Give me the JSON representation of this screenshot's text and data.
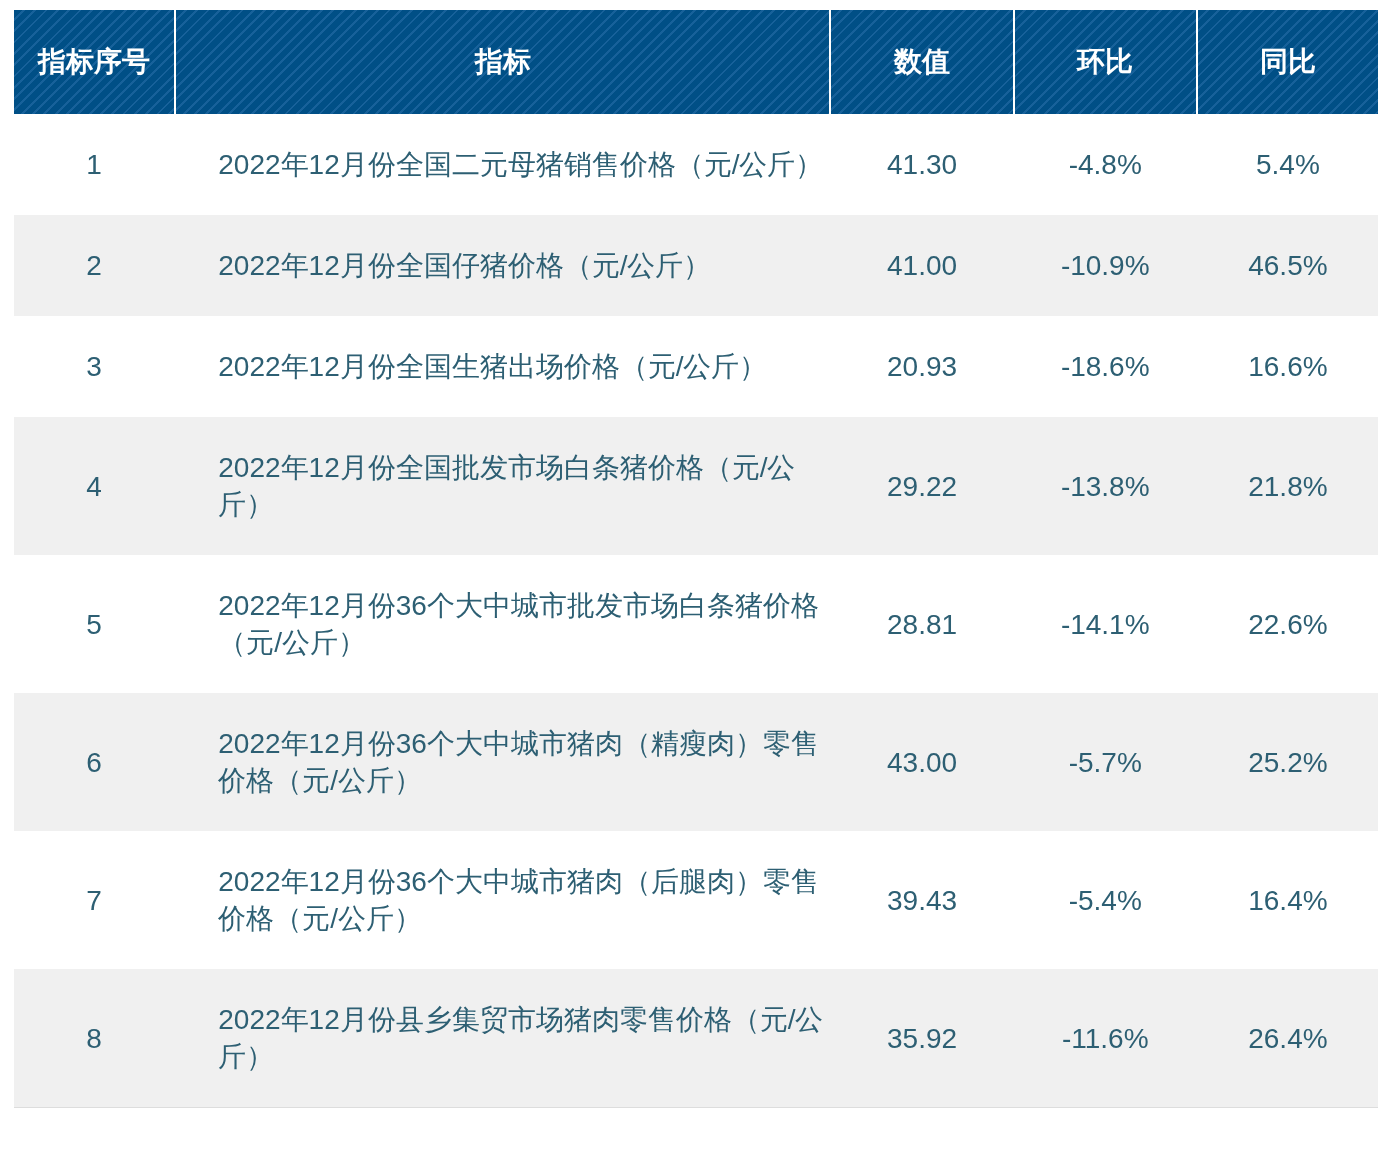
{
  "table": {
    "columns": [
      "指标序号",
      "指标",
      "数值",
      "环比",
      "同比"
    ],
    "rows": [
      {
        "cells": [
          "1",
          "2022年12月份全国二元母猪销售价格（元/公斤）",
          "41.30",
          "-4.8%",
          "5.4%"
        ]
      },
      {
        "cells": [
          "2",
          "2022年12月份全国仔猪价格（元/公斤）",
          "41.00",
          "-10.9%",
          "46.5%"
        ]
      },
      {
        "cells": [
          "3",
          "2022年12月份全国生猪出场价格（元/公斤）",
          "20.93",
          "-18.6%",
          "16.6%"
        ]
      },
      {
        "cells": [
          "4",
          "2022年12月份全国批发市场白条猪价格（元/公斤）",
          "29.22",
          "-13.8%",
          "21.8%"
        ]
      },
      {
        "cells": [
          "5",
          "2022年12月份36个大中城市批发市场白条猪价格（元/公斤）",
          "28.81",
          "-14.1%",
          "22.6%"
        ]
      },
      {
        "cells": [
          "6",
          "2022年12月份36个大中城市猪肉（精瘦肉）零售价格（元/公斤）",
          "43.00",
          "-5.7%",
          "25.2%"
        ]
      },
      {
        "cells": [
          "7",
          "2022年12月份36个大中城市猪肉（后腿肉）零售价格（元/公斤）",
          "39.43",
          "-5.4%",
          "16.4%"
        ]
      },
      {
        "cells": [
          "8",
          "2022年12月份县乡集贸市场猪肉零售价格（元/公斤）",
          "35.92",
          "-11.6%",
          "26.4%"
        ]
      }
    ]
  }
}
